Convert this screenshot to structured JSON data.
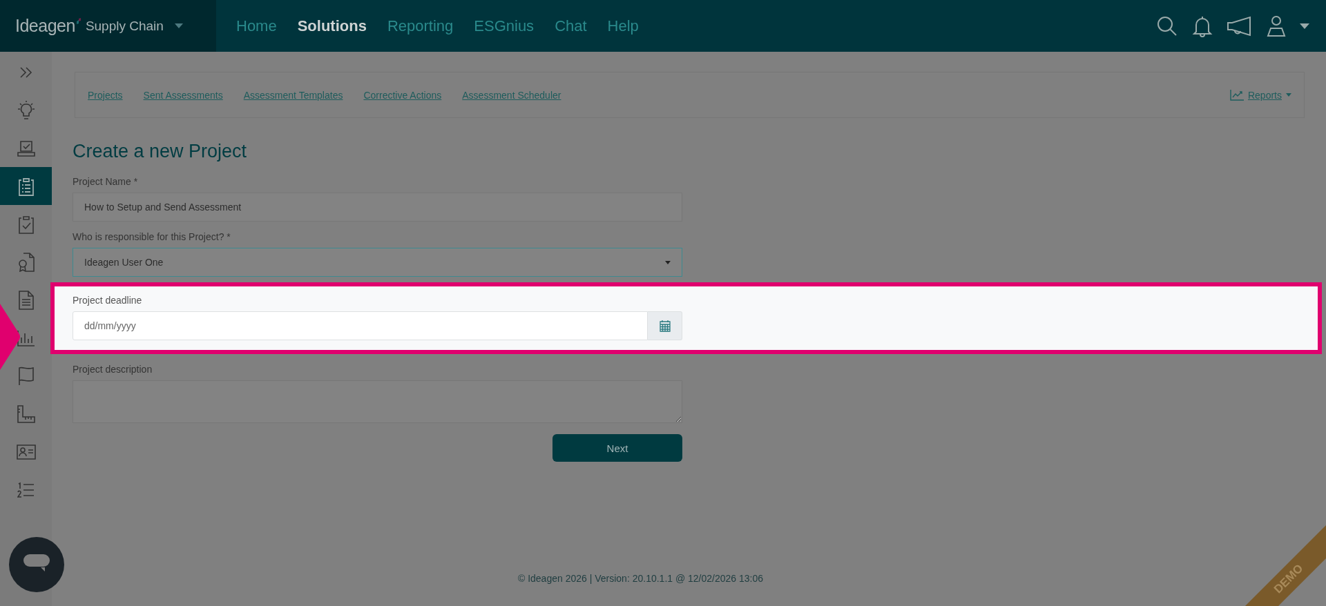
{
  "app": {
    "brand": "Ideagen",
    "product": "Supply Chain"
  },
  "nav": [
    {
      "label": "Home",
      "selected": false
    },
    {
      "label": "Solutions",
      "selected": true
    },
    {
      "label": "Reporting",
      "selected": false
    },
    {
      "label": "ESGnius",
      "selected": false
    },
    {
      "label": "Chat",
      "selected": false
    },
    {
      "label": "Help",
      "selected": false
    }
  ],
  "sidebar": {
    "items": [
      {
        "kind": "expand",
        "selected": false
      },
      {
        "kind": "bulb",
        "selected": false
      },
      {
        "kind": "tray",
        "selected": false
      },
      {
        "kind": "clipboard",
        "selected": true
      },
      {
        "kind": "clipcheck",
        "selected": false
      },
      {
        "kind": "certificate",
        "selected": false
      },
      {
        "kind": "document",
        "selected": false
      },
      {
        "kind": "chart",
        "selected": false
      },
      {
        "kind": "flag",
        "selected": false
      },
      {
        "kind": "ruler",
        "selected": false
      },
      {
        "kind": "contact",
        "selected": false
      },
      {
        "kind": "numbered",
        "selected": false
      }
    ]
  },
  "subnav": {
    "links": [
      "Projects",
      "Sent Assessments",
      "Assessment Templates",
      "Corrective Actions",
      "Assessment Scheduler"
    ],
    "reports": "Reports"
  },
  "form": {
    "title": "Create a new Project",
    "fields": [
      {
        "kind": "text",
        "label": "Project Name *",
        "value": "How to Setup and Send Assessment",
        "highlighted": false
      },
      {
        "kind": "select",
        "label": "Who is responsible for this Project? *",
        "value": "Ideagen User One",
        "highlighted": false
      },
      {
        "kind": "date",
        "label": "Project deadline",
        "placeholder": "dd/mm/yyyy",
        "highlighted": true
      },
      {
        "kind": "textarea",
        "label": "Project description",
        "highlighted": false
      }
    ],
    "submit": "Next"
  },
  "footer": "© Ideagen 2026 | Version: 20.10.1.1 @ 12/02/2026 13:06",
  "ribbon": "DEMO"
}
